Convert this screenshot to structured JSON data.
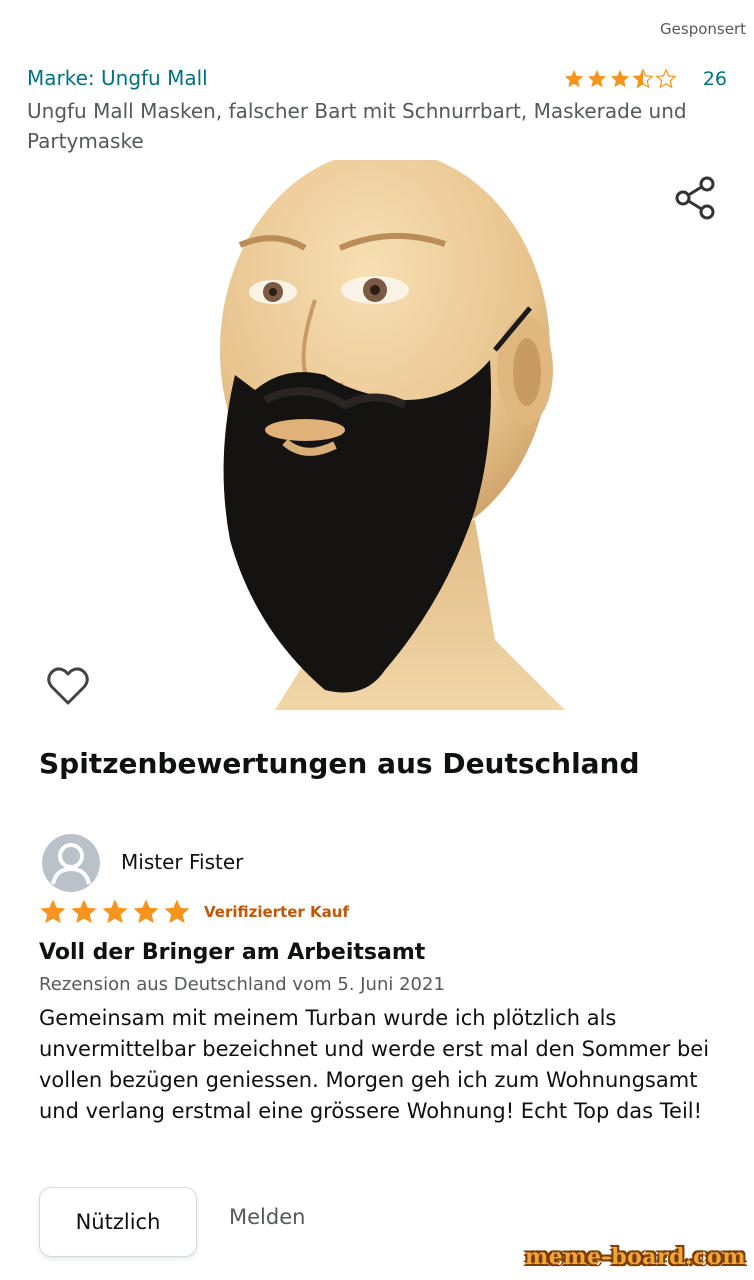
{
  "ad": {
    "sponsored_label": "Gesponsert"
  },
  "product": {
    "brand_label": "Marke: Ungfu Mall",
    "rating": 3.5,
    "review_count": "26",
    "title": "Ungfu Mall Masken, falscher Bart mit Schnurrbart, Maskerade und Partymaske",
    "image_alt": "Schaufensterpuppenkopf mit schwarzem Bart und Schnurrbart",
    "star_color": "#f7941d",
    "link_color": "#007185"
  },
  "section": {
    "title": "Spitzenbewertungen aus Deutschland"
  },
  "review": {
    "author": "Mister Fister",
    "rating": 5,
    "verified_label": "Verifizierter Kauf",
    "title": "Voll der Bringer am Arbeitsamt",
    "meta": "Rezension aus Deutschland vom 5. Juni 2021",
    "body": "Gemeinsam mit meinem Turban wurde ich plötzlich als unvermittelbar bezeichnet und werde erst mal den Sommer bei vollen bezügen geniessen. Morgen geh ich zum Wohnungsamt und verlang erstmal eine grössere Wohnung! Echt Top das Teil!",
    "helpful_label": "Nützlich",
    "report_label": "Melden"
  },
  "watermark": {
    "text": "meme-board.com"
  },
  "icons": {
    "share": "share-icon",
    "wishlist": "heart-icon",
    "avatar": "user-avatar-icon",
    "star": "star-icon"
  }
}
